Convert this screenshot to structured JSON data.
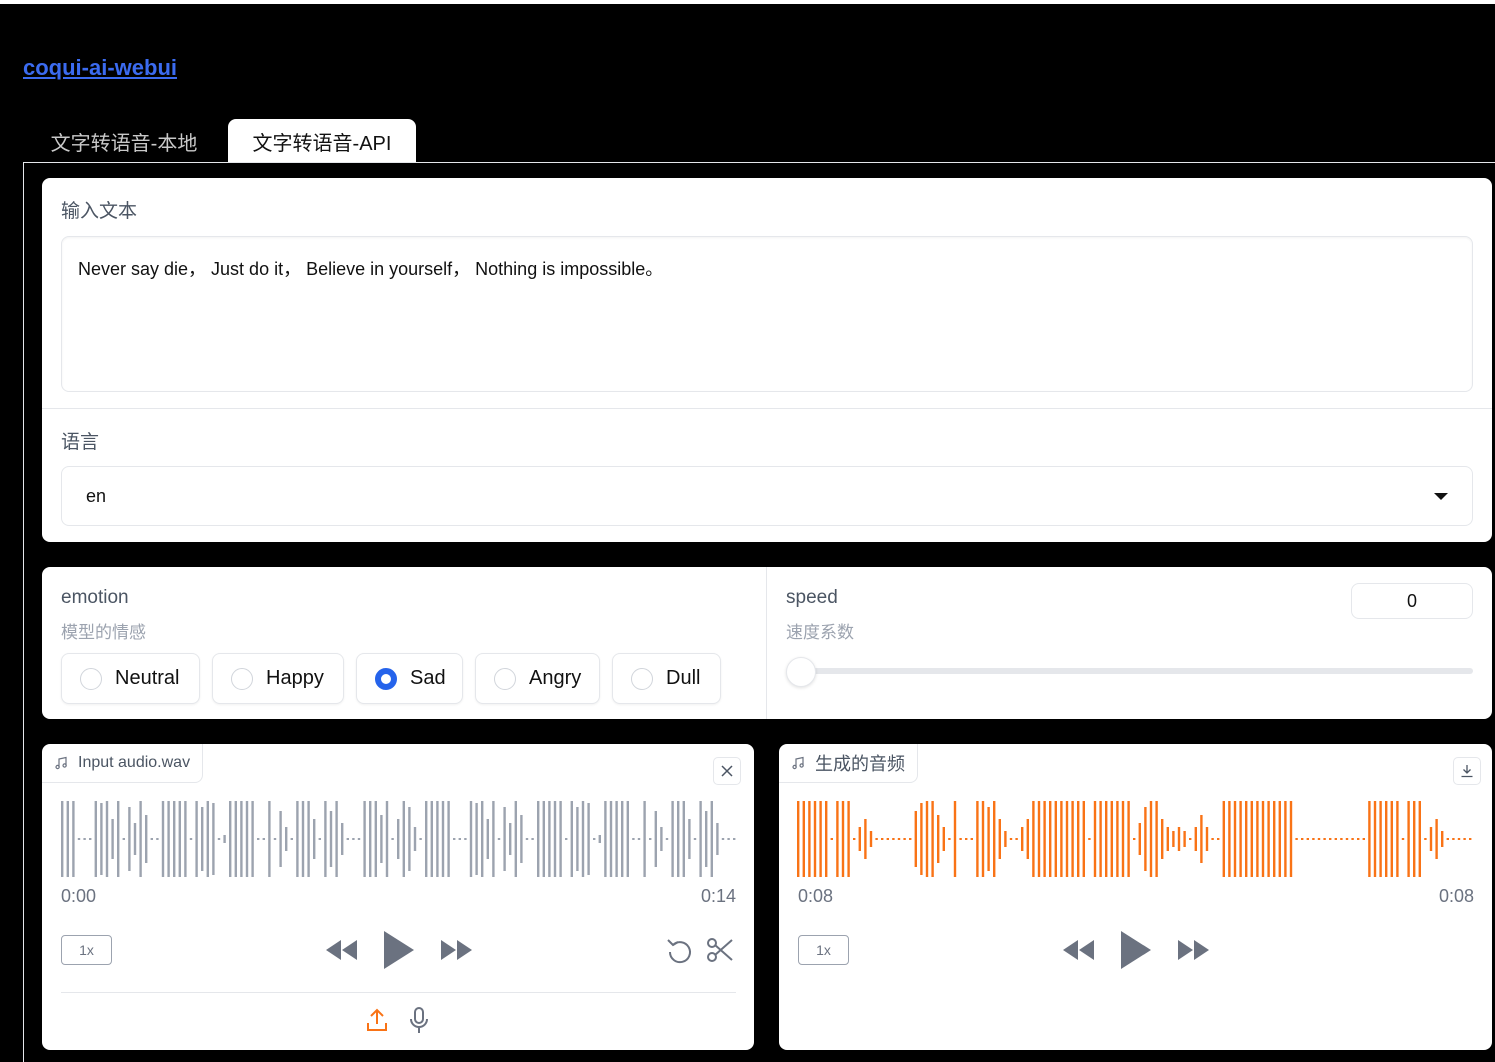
{
  "app": {
    "title": "coqui-ai-webui"
  },
  "tabs": [
    {
      "label": "文字转语音-本地",
      "active": false
    },
    {
      "label": "文字转语音-API",
      "active": true
    }
  ],
  "text_input": {
    "label": "输入文本",
    "value": "Never say die， Just do it， Believe in yourself， Nothing is impossible。"
  },
  "language": {
    "label": "语言",
    "value": "en"
  },
  "emotion": {
    "label": "emotion",
    "info": "模型的情感",
    "options": [
      "Neutral",
      "Happy",
      "Sad",
      "Angry",
      "Dull"
    ],
    "selected": "Sad"
  },
  "speed": {
    "label": "speed",
    "info": "速度系数",
    "value": "0",
    "slider_fraction": 0
  },
  "input_audio": {
    "label": "Input audio.wav",
    "current_time": "0:00",
    "duration": "0:14",
    "rate": "1x",
    "wave_color": "#9ca3af"
  },
  "output_audio": {
    "label": "生成的音频",
    "current_time": "0:08",
    "duration": "0:08",
    "rate": "1x",
    "wave_color": "#f97316"
  },
  "colors": {
    "accent_blue": "#2563eb",
    "link_blue": "#3b6bf0",
    "wave_orange": "#f97316",
    "wave_gray": "#9ca3af"
  },
  "icons": {
    "music": "music-note-icon",
    "close": "close-icon",
    "download": "download-icon",
    "rewind": "rewind-icon",
    "play": "play-icon",
    "forward": "fast-forward-icon",
    "undo": "undo-icon",
    "trim": "scissors-icon",
    "upload": "upload-icon",
    "mic": "microphone-icon"
  }
}
